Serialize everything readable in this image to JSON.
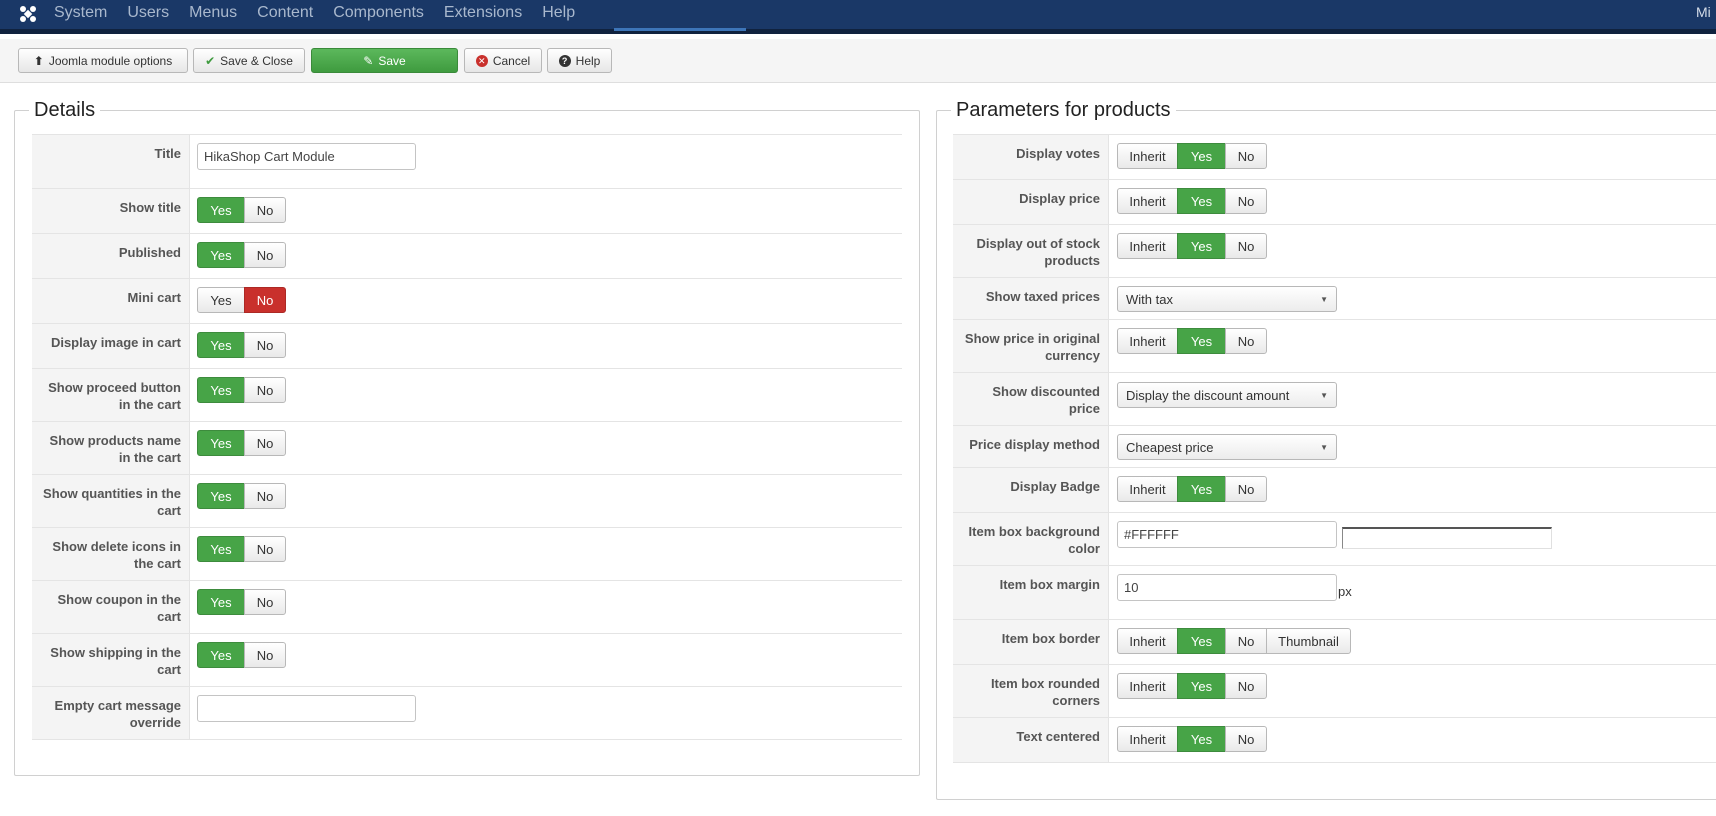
{
  "navbar": {
    "menu": [
      "System",
      "Users",
      "Menus",
      "Content",
      "Components",
      "Extensions",
      "Help"
    ],
    "user_partial": "Mi"
  },
  "toolbar": {
    "module_options": "Joomla module options",
    "save_close": "Save & Close",
    "save": "Save",
    "cancel": "Cancel",
    "help": "Help"
  },
  "details": {
    "legend": "Details",
    "title_label": "Title",
    "title_value": "HikaShop Cart Module",
    "yes": "Yes",
    "no": "No",
    "rows": [
      {
        "label": "Show title",
        "value": "Yes"
      },
      {
        "label": "Published",
        "value": "Yes"
      },
      {
        "label": "Mini cart",
        "value": "No"
      },
      {
        "label": "Display image in cart",
        "value": "Yes"
      },
      {
        "label": "Show proceed button in the cart",
        "value": "Yes"
      },
      {
        "label": "Show products name in the cart",
        "value": "Yes"
      },
      {
        "label": "Show quantities in the cart",
        "value": "Yes"
      },
      {
        "label": "Show delete icons in the cart",
        "value": "Yes"
      },
      {
        "label": "Show coupon in the cart",
        "value": "Yes"
      },
      {
        "label": "Show shipping in the cart",
        "value": "Yes"
      }
    ],
    "empty_msg_label": "Empty cart message override",
    "empty_msg_value": ""
  },
  "params": {
    "legend": "Parameters for products",
    "inherit": "Inherit",
    "yes": "Yes",
    "no": "No",
    "thumbnail": "Thumbnail",
    "display_votes": {
      "label": "Display votes",
      "value": "Yes"
    },
    "display_price": {
      "label": "Display price",
      "value": "Yes"
    },
    "display_oos": {
      "label": "Display out of stock products",
      "value": "Yes"
    },
    "taxed_prices": {
      "label": "Show taxed prices",
      "value": "With tax"
    },
    "orig_currency": {
      "label": "Show price in original currency",
      "value": "Yes"
    },
    "discounted": {
      "label": "Show discounted price",
      "value": "Display the discount amount"
    },
    "price_method": {
      "label": "Price display method",
      "value": "Cheapest price"
    },
    "badge": {
      "label": "Display Badge",
      "value": "Yes"
    },
    "bg_color": {
      "label": "Item box background color",
      "value": "#FFFFFF"
    },
    "margin": {
      "label": "Item box margin",
      "value": "10",
      "unit": "px"
    },
    "border": {
      "label": "Item box border",
      "value": "Yes"
    },
    "rounded": {
      "label": "Item box rounded corners",
      "value": "Yes"
    },
    "centered": {
      "label": "Text centered",
      "value": "Yes"
    }
  },
  "colors": {
    "navbar": "#1a3867",
    "yes_active": "#47a447",
    "no_active": "#c9302c"
  }
}
